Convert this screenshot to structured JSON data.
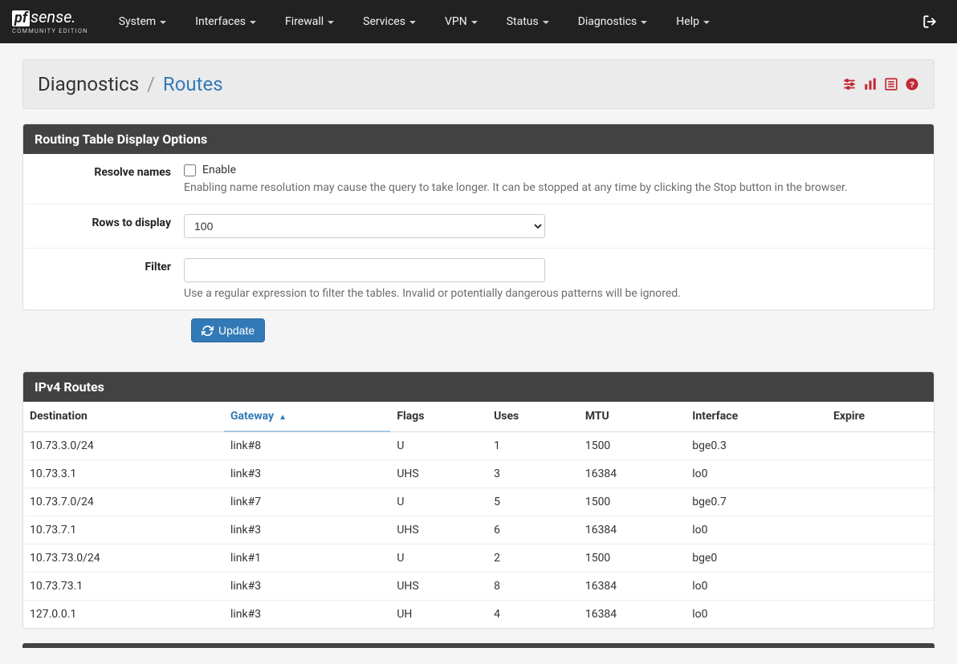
{
  "logo": {
    "pf": "pf",
    "sense": "sense",
    "edition": "COMMUNITY EDITION",
    "dot": "."
  },
  "nav": {
    "items": [
      "System",
      "Interfaces",
      "Firewall",
      "Services",
      "VPN",
      "Status",
      "Diagnostics",
      "Help"
    ]
  },
  "breadcrumb": {
    "section": "Diagnostics",
    "sep": "/",
    "page": "Routes"
  },
  "panels": {
    "options_title": "Routing Table Display Options",
    "ipv4_title": "IPv4 Routes"
  },
  "form": {
    "resolve_label": "Resolve names",
    "resolve_checkbox": "Enable",
    "resolve_help": "Enabling name resolution may cause the query to take longer. It can be stopped at any time by clicking the Stop button in the browser.",
    "rows_label": "Rows to display",
    "rows_value": "100",
    "filter_label": "Filter",
    "filter_value": "",
    "filter_help": "Use a regular expression to filter the tables. Invalid or potentially dangerous patterns will be ignored."
  },
  "buttons": {
    "update": "Update"
  },
  "table": {
    "headers": {
      "destination": "Destination",
      "gateway": "Gateway",
      "flags": "Flags",
      "uses": "Uses",
      "mtu": "MTU",
      "interface": "Interface",
      "expire": "Expire"
    },
    "sorted_column": "gateway",
    "rows": [
      {
        "destination": "10.73.3.0/24",
        "gateway": "link#8",
        "flags": "U",
        "uses": "1",
        "mtu": "1500",
        "interface": "bge0.3",
        "expire": ""
      },
      {
        "destination": "10.73.3.1",
        "gateway": "link#3",
        "flags": "UHS",
        "uses": "3",
        "mtu": "16384",
        "interface": "lo0",
        "expire": ""
      },
      {
        "destination": "10.73.7.0/24",
        "gateway": "link#7",
        "flags": "U",
        "uses": "5",
        "mtu": "1500",
        "interface": "bge0.7",
        "expire": ""
      },
      {
        "destination": "10.73.7.1",
        "gateway": "link#3",
        "flags": "UHS",
        "uses": "6",
        "mtu": "16384",
        "interface": "lo0",
        "expire": ""
      },
      {
        "destination": "10.73.73.0/24",
        "gateway": "link#1",
        "flags": "U",
        "uses": "2",
        "mtu": "1500",
        "interface": "bge0",
        "expire": ""
      },
      {
        "destination": "10.73.73.1",
        "gateway": "link#3",
        "flags": "UHS",
        "uses": "8",
        "mtu": "16384",
        "interface": "lo0",
        "expire": ""
      },
      {
        "destination": "127.0.0.1",
        "gateway": "link#3",
        "flags": "UH",
        "uses": "4",
        "mtu": "16384",
        "interface": "lo0",
        "expire": ""
      }
    ]
  }
}
